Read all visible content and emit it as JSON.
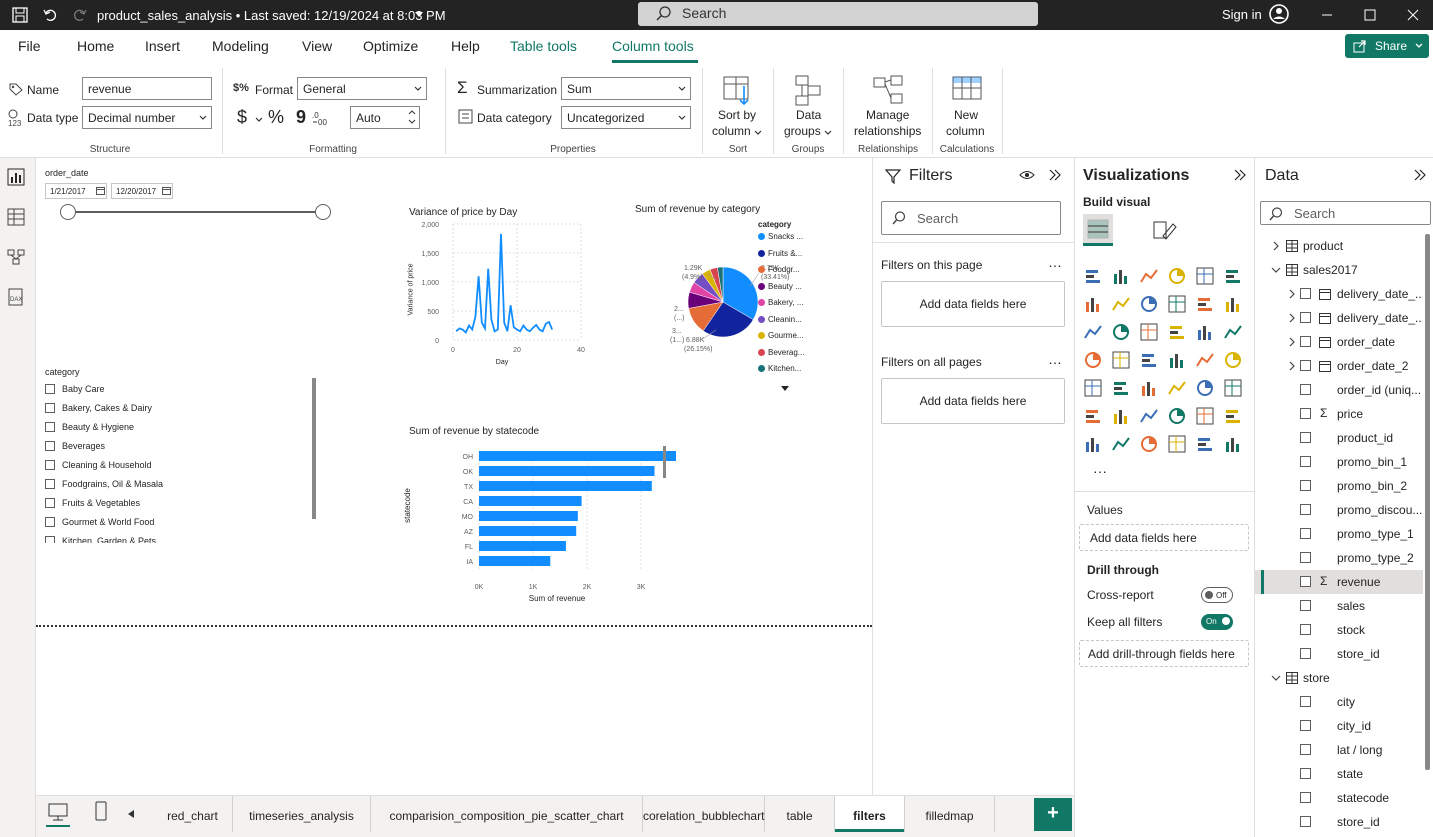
{
  "titlebar": {
    "title": "product_sales_analysis • Last saved: 12/19/2024 at 8:03 PM",
    "search": "Search",
    "signin": "Sign in"
  },
  "menu": {
    "file": "File",
    "home": "Home",
    "insert": "Insert",
    "modeling": "Modeling",
    "view": "View",
    "optimize": "Optimize",
    "help": "Help",
    "table_tools": "Table tools",
    "column_tools": "Column tools",
    "share": "Share"
  },
  "ribbon": {
    "name_label": "Name",
    "name_value": "revenue",
    "datatype_label": "Data type",
    "datatype_value": "Decimal number",
    "structure": "Structure",
    "format_label": "Format",
    "format_value": "General",
    "currency": "$",
    "percent": "%",
    "comma": "9",
    "auto_value": "Auto",
    "formatting": "Formatting",
    "summarization_label": "Summarization",
    "summarization_value": "Sum",
    "datacategory_label": "Data category",
    "datacategory_value": "Uncategorized",
    "properties": "Properties",
    "sort_by_column": "Sort by",
    "sort_by_column2": "column",
    "sort": "Sort",
    "data_groups": "Data",
    "data_groups2": "groups",
    "groups": "Groups",
    "manage_rel": "Manage",
    "manage_rel2": "relationships",
    "relationships": "Relationships",
    "new_column": "New",
    "new_column2": "column",
    "calculations": "Calculations"
  },
  "canvas": {
    "slicer_date": {
      "title": "order_date",
      "from": "1/21/2017",
      "to": "12/20/2017"
    },
    "slicer_category": {
      "title": "category",
      "items": [
        "Baby Care",
        "Bakery, Cakes & Dairy",
        "Beauty & Hygiene",
        "Beverages",
        "Cleaning & Household",
        "Foodgrains, Oil & Masala",
        "Fruits & Vegetables",
        "Gourmet & World Food",
        "Kitchen, Garden & Pets"
      ]
    },
    "line_title": "Variance of price by Day",
    "line_ylabel": "Variance of price",
    "line_xlabel": "Day",
    "pie_title": "Sum of revenue by category",
    "pie_legend_title": "category",
    "pie_labels": {
      "a": "8.79K",
      "a2": "(33.41%)",
      "b": "6.88K",
      "b2": "(26.15%)",
      "c": "1.29K",
      "c2": "(4.9%)",
      "d": "2...",
      "d2": "(...)",
      "e": "3...",
      "e2": "(1...)"
    },
    "bar_title": "Sum of revenue by statecode",
    "bar_ylabel": "statecode",
    "bar_xlabel": "Sum of revenue"
  },
  "chart_data": [
    {
      "type": "line",
      "title": "Variance of price by Day",
      "xlabel": "Day",
      "ylabel": "Variance of price",
      "xlim": [
        0,
        40
      ],
      "ylim": [
        0,
        2000
      ],
      "x_ticks": [
        "0",
        "20",
        "40"
      ],
      "y_ticks": [
        "0",
        "500",
        "1,000",
        "1,500",
        "2,000"
      ],
      "x": [
        1,
        2,
        3,
        4,
        5,
        6,
        7,
        8,
        9,
        10,
        11,
        12,
        13,
        14,
        15,
        16,
        17,
        18,
        19,
        20,
        21,
        22,
        23,
        24,
        25,
        26,
        27,
        28,
        29,
        30,
        31
      ],
      "y": [
        150,
        200,
        180,
        130,
        250,
        180,
        400,
        1100,
        300,
        200,
        1230,
        350,
        150,
        180,
        1830,
        300,
        150,
        600,
        220,
        180,
        150,
        250,
        180,
        150,
        210,
        260,
        180,
        150,
        280,
        310,
        180
      ]
    },
    {
      "type": "pie",
      "title": "Sum of revenue by category",
      "categories": [
        "Snacks ...",
        "Fruits &...",
        "Foodgr...",
        "Beauty ...",
        "Bakery, ...",
        "Cleanin...",
        "Gourme...",
        "Beverag...",
        "Kitchen..."
      ],
      "values": [
        33.41,
        26.15,
        12.5,
        7.5,
        4.9,
        5.5,
        4.0,
        3.5,
        2.54
      ],
      "colors": [
        "#118dff",
        "#12239e",
        "#e66c37",
        "#6b007b",
        "#e044a7",
        "#744ec2",
        "#d9b300",
        "#d64550",
        "#197278"
      ]
    },
    {
      "type": "bar",
      "title": "Sum of revenue by statecode",
      "xlabel": "Sum of revenue",
      "ylabel": "statecode",
      "xlim": [
        0,
        4000
      ],
      "x_ticks": [
        "0K",
        "1K",
        "2K",
        "3K",
        "4K"
      ],
      "categories": [
        "OH",
        "OK",
        "TX",
        "CA",
        "MO",
        "AZ",
        "FL",
        "IA"
      ],
      "values": [
        3780,
        3250,
        3200,
        1900,
        1830,
        1800,
        1610,
        1320
      ]
    }
  ],
  "pages": [
    "red_chart",
    "timeseries_analysis",
    "comparision_composition_pie_scatter_chart",
    "corelation_bubblechart",
    "table",
    "filters",
    "filledmap"
  ],
  "filters": {
    "title": "Filters",
    "search": "Search",
    "on_page": "Filters on this page",
    "on_all": "Filters on all pages",
    "add": "Add data fields here"
  },
  "viz": {
    "title": "Visualizations",
    "build": "Build visual",
    "values": "Values",
    "add": "Add data fields here",
    "drill": "Drill through",
    "cross": "Cross-report",
    "off": "Off",
    "keep": "Keep all filters",
    "on": "On",
    "add_drill": "Add drill-through fields here"
  },
  "data": {
    "title": "Data",
    "search": "Search",
    "tables": [
      {
        "name": "product",
        "expanded": false
      },
      {
        "name": "sales2017",
        "expanded": true,
        "fields": [
          {
            "name": "delivery_date_...",
            "kind": "date",
            "expand": true
          },
          {
            "name": "delivery_date_...",
            "kind": "date",
            "expand": true
          },
          {
            "name": "order_date",
            "kind": "date",
            "expand": true
          },
          {
            "name": "order_date_2",
            "kind": "date",
            "expand": true
          },
          {
            "name": "order_id (uniq...",
            "kind": "plain"
          },
          {
            "name": "price",
            "kind": "sum"
          },
          {
            "name": "product_id",
            "kind": "plain"
          },
          {
            "name": "promo_bin_1",
            "kind": "plain"
          },
          {
            "name": "promo_bin_2",
            "kind": "plain"
          },
          {
            "name": "promo_discou...",
            "kind": "plain"
          },
          {
            "name": "promo_type_1",
            "kind": "plain"
          },
          {
            "name": "promo_type_2",
            "kind": "plain"
          },
          {
            "name": "revenue",
            "kind": "sum",
            "selected": true
          },
          {
            "name": "sales",
            "kind": "plain"
          },
          {
            "name": "stock",
            "kind": "plain"
          },
          {
            "name": "store_id",
            "kind": "plain"
          }
        ]
      },
      {
        "name": "store",
        "expanded": true,
        "fields": [
          {
            "name": "city",
            "kind": "plain"
          },
          {
            "name": "city_id",
            "kind": "plain"
          },
          {
            "name": "lat / long",
            "kind": "plain"
          },
          {
            "name": "state",
            "kind": "plain"
          },
          {
            "name": "statecode",
            "kind": "plain"
          },
          {
            "name": "store_id",
            "kind": "plain"
          }
        ]
      }
    ]
  }
}
